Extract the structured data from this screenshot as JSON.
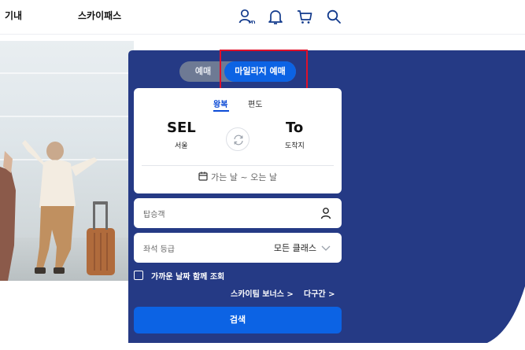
{
  "nav": {
    "links": [
      "기내",
      "스카이패스"
    ],
    "icons": [
      "my-account-icon",
      "bell-icon",
      "cart-icon",
      "search-icon"
    ],
    "my_badge": "MY"
  },
  "toggle": {
    "reserve_label": "예매",
    "mileage_label": "마일리지 예매"
  },
  "trip": {
    "tabs": [
      "왕복",
      "편도"
    ],
    "active_tab": "왕복",
    "origin": {
      "code": "SEL",
      "name": "서울"
    },
    "destination": {
      "code": "To",
      "name": "도착지"
    },
    "date_placeholder": "가는 날 ~ 오는 날"
  },
  "passenger": {
    "label": "탑승객"
  },
  "seat_class": {
    "label": "좌석 등급",
    "value": "모든 클래스"
  },
  "nearby_dates_label": "가까운 날짜 함께 조회",
  "links": [
    "스카이팀 보너스 >",
    "다구간 >"
  ],
  "search_label": "검색",
  "colors": {
    "panel": "#253a85",
    "accent": "#0c63e4",
    "toggle_bg": "#6e7a94",
    "highlight": "#e0102a"
  }
}
